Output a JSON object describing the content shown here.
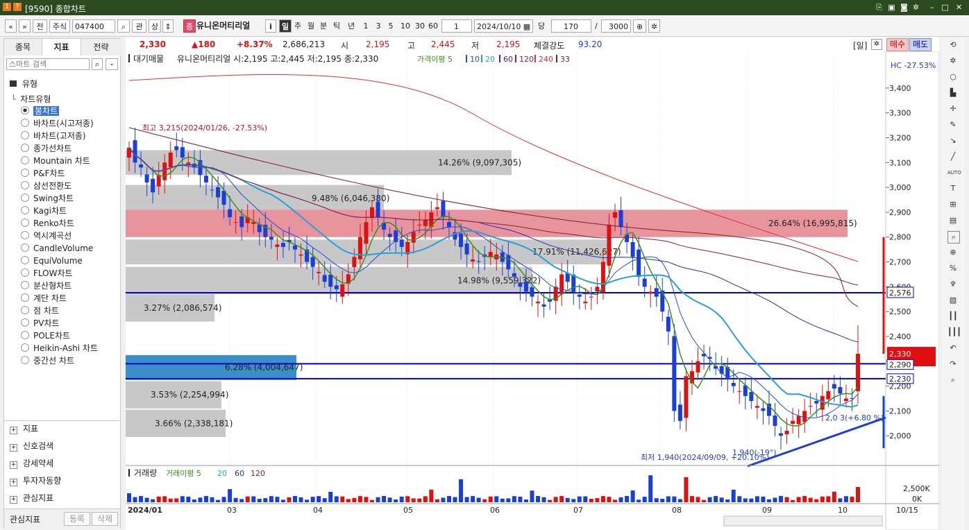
{
  "titlebar": {
    "title": "[9590] 종합차트",
    "icons": [
      "1",
      "?"
    ]
  },
  "toolbar": {
    "nav_prev": "«",
    "nav_down": "»",
    "btn_jeon": "전",
    "market": "주식",
    "code": "047400",
    "btn_gwan": "관",
    "btn_sang": "상",
    "badge": "증",
    "stock_name": "유니온머티리얼",
    "info_btn": "i",
    "periods": [
      "일",
      "주",
      "월",
      "분",
      "틱",
      "년"
    ],
    "minutes": [
      "1",
      "3",
      "5",
      "10",
      "30",
      "60"
    ],
    "count_small": "1",
    "date": "2024/10/10",
    "btn_dang": "당",
    "count": "170",
    "slash": "/",
    "total": "3000"
  },
  "left": {
    "tabs": [
      "종목",
      "지표",
      "전략"
    ],
    "search_placeholder": "스마트 검색",
    "root": "유형",
    "group": "차트유형",
    "items": [
      "봉차트",
      "바차트(시고저종)",
      "바차트(고저종)",
      "종가선차트",
      "Mountain 차트",
      "P&F차트",
      "삼선전환도",
      "Swing차트",
      "Kagi차트",
      "Renko차트",
      "역시계곡선",
      "CandleVolume",
      "EquiVolume",
      "FLOW차트",
      "분산형차트",
      "계단 차트",
      "점 차트",
      "PV차트",
      "POLE차트",
      "Heikin-Ashi 차트",
      "중간선 차트"
    ],
    "bottom": [
      "지표",
      "신호검색",
      "강세약세",
      "투자자동향",
      "관심지표"
    ],
    "footer_label": "관심지표",
    "btn_register": "등록",
    "btn_delete": "삭제"
  },
  "infobar": {
    "price": "2,330",
    "change": "▲180",
    "pct": "+8.37%",
    "volume": "2,686,213",
    "open_label": "시",
    "open": "2,195",
    "high_label": "고",
    "high": "2,445",
    "low_label": "저",
    "low": "2,195",
    "strength_label": "체결강도",
    "strength": "93.20",
    "period_tag": "[일]",
    "buy": "매수",
    "sell": "매도"
  },
  "chart": {
    "legend_prefix": "대기매물",
    "legend_text": "유니온머티리얼 시:2,195 고:2,445 저:2,195 종:2,330",
    "legend_ma_label": "가격이평 5",
    "legend_ma": [
      "10",
      "20",
      "60",
      "120",
      "240",
      "33"
    ],
    "hc": "HC -27.53%",
    "max_label": "최고 3,215(2024/01/26, -27.53%)",
    "min_label": "최저 1,940(2024/09/09, +20.10%)",
    "trend_label": "1,940(-19°)",
    "pivot_label": "2,0 3(+6.80 %)",
    "vp_labels": [
      "14.26% (9,097,305)",
      "9.48% (6,046,380)",
      "26.64% (16,995,815)",
      "17.91% (11,426,627)",
      "14.98% (9,559,322)",
      "3.27% (2,086,574)",
      "6.28% (4,004,647)",
      "3.53% (2,254,994)",
      "3.66% (2,338,181)"
    ],
    "y_ticks": [
      "3,400",
      "3,300",
      "3,200",
      "3,100",
      "3,000",
      "2,900",
      "2,800",
      "2,700",
      "2,600",
      "2,500",
      "2,400",
      "2,300",
      "2,200",
      "2,100",
      "2,000"
    ],
    "hline_labels": [
      "2,576",
      "2,330",
      "2,290",
      "2,230"
    ],
    "vol_legend": [
      "거래량",
      "거래이평 5",
      "20",
      "60",
      "120"
    ],
    "vol_ticks": [
      "2,500K",
      "0K"
    ],
    "x_labels": [
      "2024/01",
      "03",
      "04",
      "05",
      "06",
      "07",
      "08",
      "09",
      "10",
      "10/15"
    ],
    "colors": {
      "up": "#e01010",
      "down": "#1a3fd6",
      "vp_gray": "#c8c8c8",
      "vp_red": "#e8949c",
      "vp_blue": "#3b8fc9"
    }
  },
  "chart_data": {
    "type": "candlestick",
    "y_axis": {
      "min": 1900,
      "max": 3450
    },
    "last": {
      "open": 2195,
      "high": 2445,
      "low": 2195,
      "close": 2330
    }
  }
}
